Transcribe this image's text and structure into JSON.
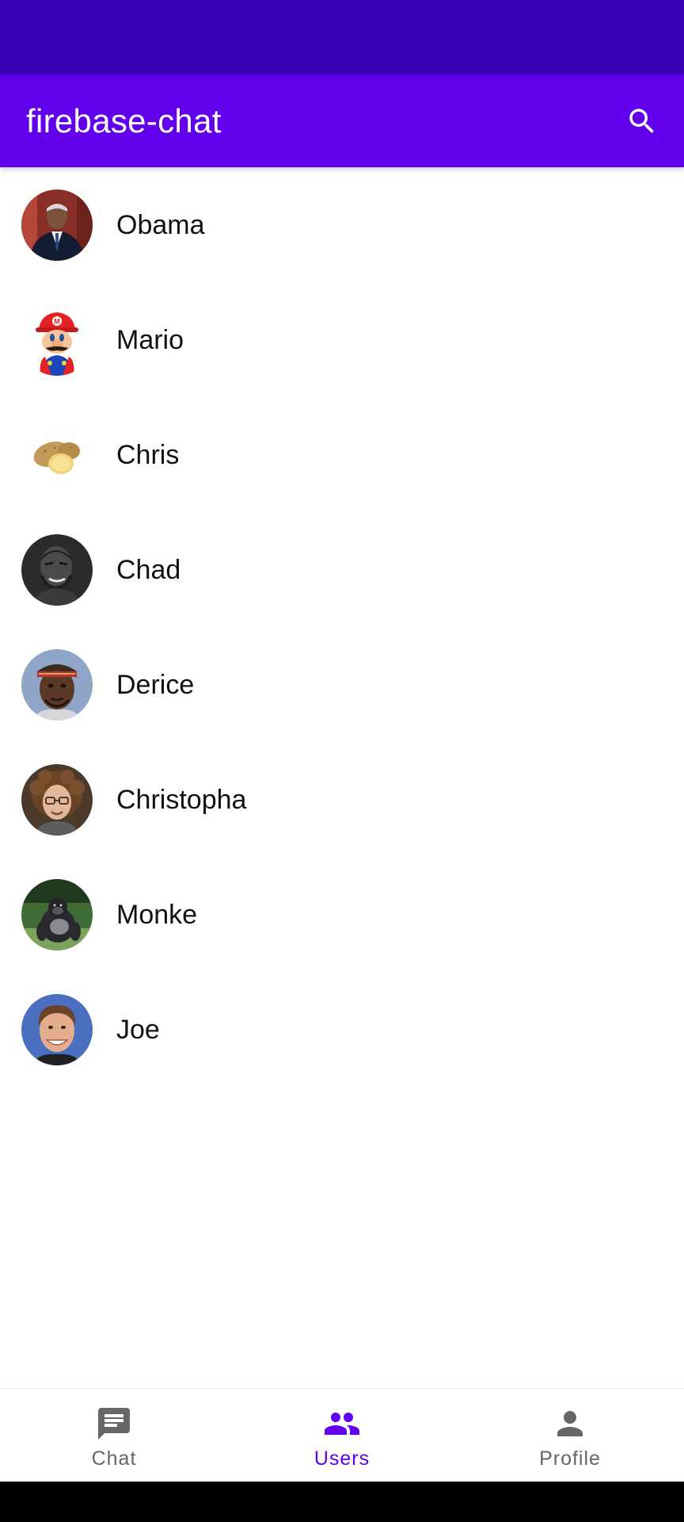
{
  "app_bar": {
    "title": "firebase-chat",
    "background": "#6200ee",
    "status_bar_color": "#3700b3",
    "action_icon": "search-icon"
  },
  "users": [
    {
      "name": "Obama",
      "avatar": "obama-photo"
    },
    {
      "name": "Mario",
      "avatar": "mario-image"
    },
    {
      "name": "Chris",
      "avatar": "potato-image"
    },
    {
      "name": "Chad",
      "avatar": "chad-photo"
    },
    {
      "name": "Derice",
      "avatar": "derice-photo"
    },
    {
      "name": "Christopha",
      "avatar": "christopha-photo"
    },
    {
      "name": "Monke",
      "avatar": "gorilla-photo"
    },
    {
      "name": "Joe",
      "avatar": "joe-photo"
    }
  ],
  "bottom_nav": {
    "active_color": "#6200ee",
    "inactive_color": "#666666",
    "items": [
      {
        "label": "Chat",
        "icon": "chat-icon",
        "active": false
      },
      {
        "label": "Users",
        "icon": "users-icon",
        "active": true
      },
      {
        "label": "Profile",
        "icon": "profile-icon",
        "active": false
      }
    ]
  }
}
